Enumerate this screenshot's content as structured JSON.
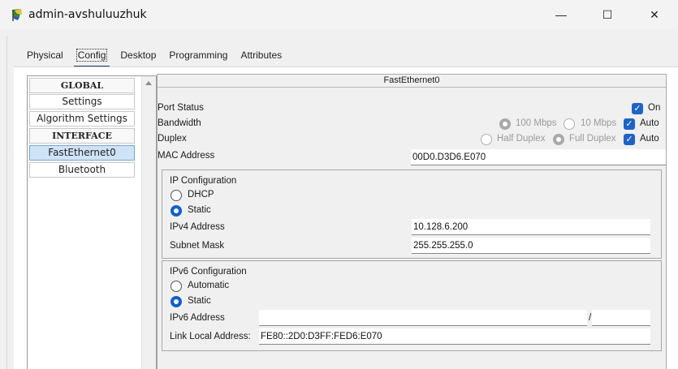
{
  "window": {
    "title": "admin-avshuluuzhuk",
    "minimize_glyph": "—",
    "maximize_glyph": "☐",
    "close_glyph": "✕"
  },
  "tabs": [
    {
      "label": "Physical"
    },
    {
      "label": "Config"
    },
    {
      "label": "Desktop"
    },
    {
      "label": "Programming"
    },
    {
      "label": "Attributes"
    }
  ],
  "sidebar": {
    "items": [
      {
        "label": "GLOBAL"
      },
      {
        "label": "Settings"
      },
      {
        "label": "Algorithm Settings"
      },
      {
        "label": "INTERFACE"
      },
      {
        "label": "FastEthernet0"
      },
      {
        "label": "Bluetooth"
      }
    ]
  },
  "interface": {
    "title": "FastEthernet0",
    "port_status": {
      "label": "Port Status",
      "on_label": "On",
      "on": true
    },
    "bandwidth": {
      "label": "Bandwidth",
      "opt1": "100 Mbps",
      "opt2": "10 Mbps",
      "auto_label": "Auto"
    },
    "duplex": {
      "label": "Duplex",
      "opt1": "Half Duplex",
      "opt2": "Full Duplex",
      "auto_label": "Auto"
    },
    "mac": {
      "label": "MAC Address",
      "value": "00D0.D3D6.E070"
    }
  },
  "ipv4": {
    "title": "IP Configuration",
    "dhcp_label": "DHCP",
    "static_label": "Static",
    "address_label": "IPv4 Address",
    "address_value": "10.128.6.200",
    "mask_label": "Subnet Mask",
    "mask_value": "255.255.255.0"
  },
  "ipv6": {
    "title": "IPv6 Configuration",
    "automatic_label": "Automatic",
    "static_label": "Static",
    "address_label": "IPv6 Address",
    "address_value": "",
    "prefix_separator": "/",
    "prefix_value": "",
    "link_local_label": "Link Local Address:",
    "link_local_value": "FE80::2D0:D3FF:FED6:E070"
  },
  "colors": {
    "accent": "#1e63c8",
    "tab_underline": "#1e3f66"
  }
}
